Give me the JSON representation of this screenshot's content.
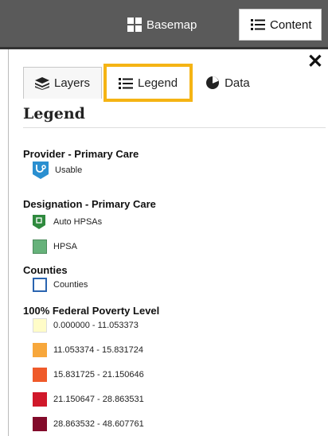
{
  "topbar": {
    "basemap_label": "Basemap",
    "content_label": "Content"
  },
  "tabs": [
    {
      "label": "Layers",
      "icon": "layers-icon"
    },
    {
      "label": "Legend",
      "icon": "list-icon"
    },
    {
      "label": "Data",
      "icon": "pie-chart-icon"
    }
  ],
  "active_tab": "Legend",
  "legend": {
    "title": "Legend",
    "groups": [
      {
        "title": "Provider - Primary Care",
        "items": [
          {
            "label": "Usable",
            "icon": "stethoscope-marker-icon"
          }
        ]
      },
      {
        "title": "Designation - Primary Care",
        "items": [
          {
            "label": "Auto HPSAs",
            "icon": "green-marker-icon"
          },
          {
            "label": "HPSA",
            "color": "#66b27a"
          }
        ]
      },
      {
        "title": "Counties",
        "items": [
          {
            "label": "Counties",
            "outline": "#2a64b0"
          }
        ]
      },
      {
        "title": "100% Federal Poverty Level",
        "items": [
          {
            "label": "0.000000 - 11.053373",
            "color": "#fffcc8"
          },
          {
            "label": "11.053374 - 15.831724",
            "color": "#f7a73b"
          },
          {
            "label": "15.831725 - 21.150646",
            "color": "#ef5a2a"
          },
          {
            "label": "21.150647 - 28.863531",
            "color": "#d0182a"
          },
          {
            "label": "28.863532 - 48.607761",
            "color": "#820a2a"
          }
        ]
      }
    ]
  },
  "colors": {
    "topbar": "#5a5a5a",
    "active_tab_outline": "#f5b414",
    "provider_icon": "#2a8fd0",
    "auto_hpsa_icon": "#2f8a3e"
  }
}
